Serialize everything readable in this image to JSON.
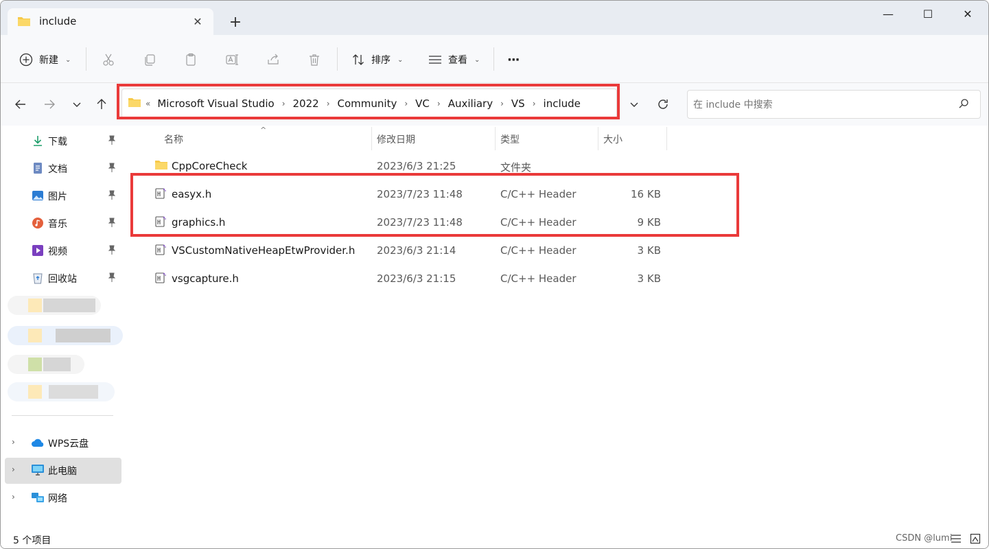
{
  "window": {
    "tab_title": "include",
    "new_tab_label": "+",
    "minimize_label": "—",
    "maximize_label": "☐",
    "close_label": "✕"
  },
  "toolbar": {
    "new_label": "新建",
    "sort_label": "排序",
    "view_label": "查看",
    "more_label": "···"
  },
  "address": {
    "collapsed": "«",
    "crumbs": [
      "Microsoft Visual Studio",
      "2022",
      "Community",
      "VC",
      "Auxiliary",
      "VS",
      "include"
    ]
  },
  "search": {
    "placeholder": "在 include 中搜索"
  },
  "sidebar": {
    "pinned": [
      {
        "label": "下载",
        "icon": "download-icon"
      },
      {
        "label": "文档",
        "icon": "document-icon"
      },
      {
        "label": "图片",
        "icon": "picture-icon"
      },
      {
        "label": "音乐",
        "icon": "music-icon"
      },
      {
        "label": "视频",
        "icon": "video-icon"
      },
      {
        "label": "回收站",
        "icon": "recycle-bin-icon"
      }
    ],
    "locations": [
      {
        "label": "WPS云盘",
        "icon": "cloud-icon"
      },
      {
        "label": "此电脑",
        "icon": "computer-icon"
      },
      {
        "label": "网络",
        "icon": "network-icon"
      }
    ]
  },
  "columns": {
    "name": "名称",
    "date": "修改日期",
    "type": "类型",
    "size": "大小"
  },
  "files": [
    {
      "name": "CppCoreCheck",
      "date": "2023/6/3 21:25",
      "type": "文件夹",
      "size": "",
      "kind": "folder"
    },
    {
      "name": "easyx.h",
      "date": "2023/7/23 11:48",
      "type": "C/C++ Header",
      "size": "16 KB",
      "kind": "header"
    },
    {
      "name": "graphics.h",
      "date": "2023/7/23 11:48",
      "type": "C/C++ Header",
      "size": "9 KB",
      "kind": "header"
    },
    {
      "name": "VSCustomNativeHeapEtwProvider.h",
      "date": "2023/6/3 21:14",
      "type": "C/C++ Header",
      "size": "3 KB",
      "kind": "header"
    },
    {
      "name": "vsgcapture.h",
      "date": "2023/6/3 21:15",
      "type": "C/C++ Header",
      "size": "3 KB",
      "kind": "header"
    }
  ],
  "status": {
    "item_count": "5 个项目",
    "watermark": "CSDN @lumi"
  },
  "colors": {
    "highlight_box": "#ea3a3a",
    "folder": "#f7c948",
    "selected": "#e0e0e0"
  }
}
